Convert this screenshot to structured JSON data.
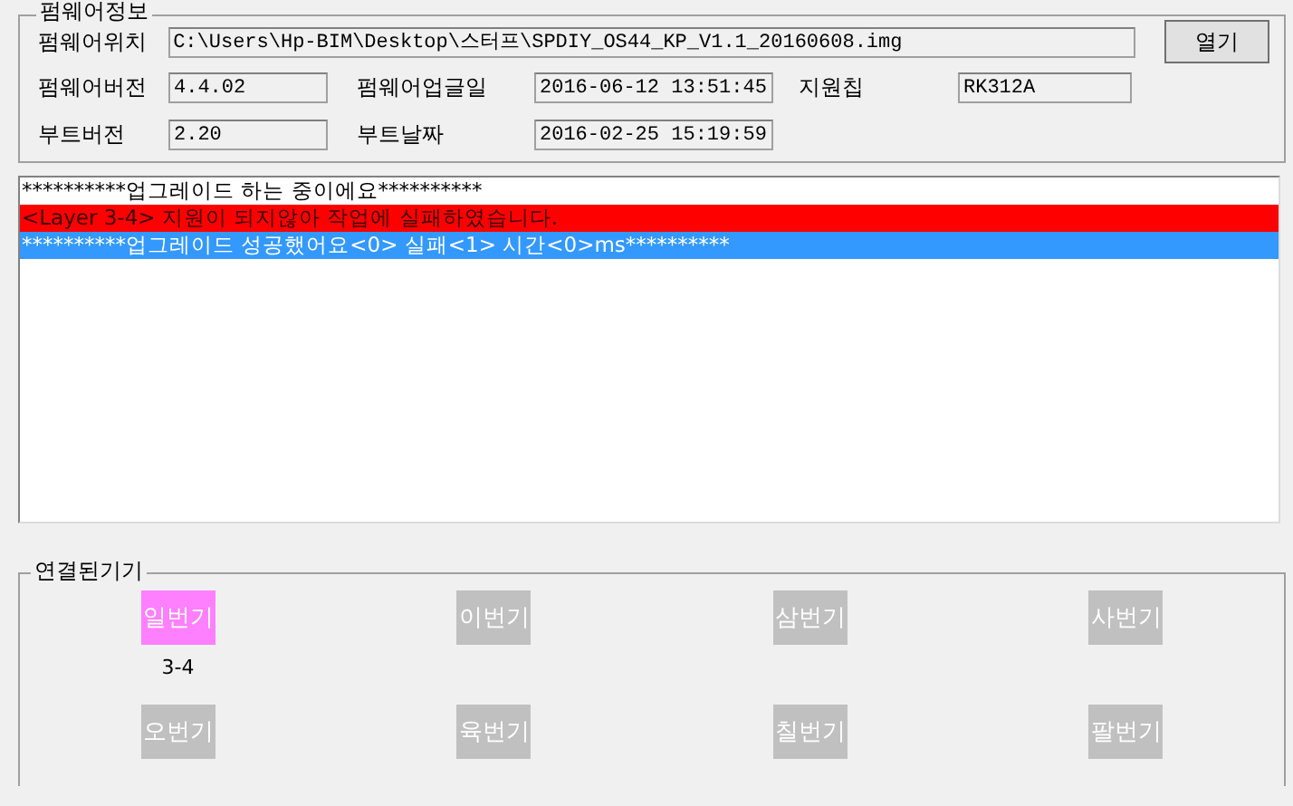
{
  "firmware_info": {
    "title": "펌웨어정보",
    "location": {
      "label": "펌웨어위치",
      "value": "C:\\Users\\Hp-BIM\\Desktop\\스터프\\SPDIY_OS44_KP_V1.1_20160608.img"
    },
    "open_button": "열기",
    "fields": [
      {
        "label": "펌웨어버전",
        "value": "4.4.02"
      },
      {
        "label": "펌웨어업글일",
        "value": "2016-06-12 13:51:45"
      },
      {
        "label": "지원칩",
        "value": "RK312A"
      },
      {
        "label": "부트버전",
        "value": "2.20"
      },
      {
        "label": "부트날짜",
        "value": "2016-02-25 15:19:59"
      }
    ]
  },
  "log": [
    {
      "kind": "info",
      "text": "**********업그레이드 하는 중이에요**********"
    },
    {
      "kind": "error",
      "text": "<Layer 3-4> 지원이 되지않아 작업에 실패하였습니다."
    },
    {
      "kind": "success",
      "text": "**********업그레이드 성공했어요<0> 실패<1> 시간<0>ms**********"
    }
  ],
  "devices": {
    "title": "연결된기기",
    "items": [
      {
        "name": "일번기",
        "active": true,
        "port": "3-4"
      },
      {
        "name": "이번기",
        "active": false
      },
      {
        "name": "삼번기",
        "active": false
      },
      {
        "name": "사번기",
        "active": false
      },
      {
        "name": "오번기",
        "active": false
      },
      {
        "name": "육번기",
        "active": false
      },
      {
        "name": "칠번기",
        "active": false
      },
      {
        "name": "팔번기",
        "active": false
      }
    ]
  }
}
